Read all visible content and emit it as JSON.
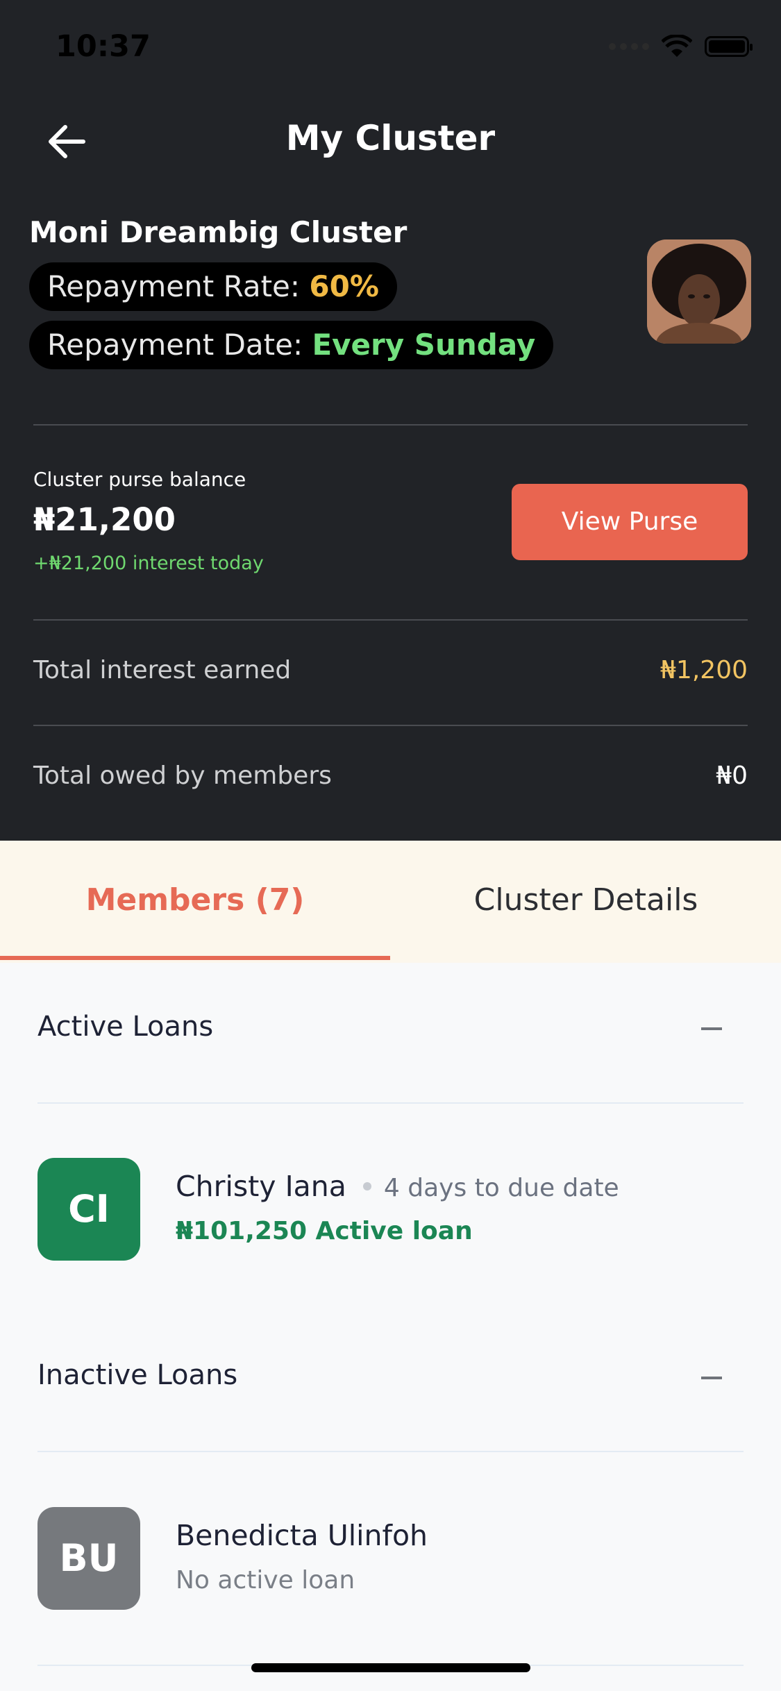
{
  "status": {
    "time": "10:37"
  },
  "header": {
    "title": "My Cluster"
  },
  "cluster": {
    "name": "Moni Dreambig Cluster",
    "repayment_rate_label": "Repayment Rate: ",
    "repayment_rate_value": "60%",
    "repayment_date_label": "Repayment Date: ",
    "repayment_date_value": "Every Sunday"
  },
  "purse": {
    "label": "Cluster purse balance",
    "amount": "₦21,200",
    "interest_today": "+₦21,200 interest today",
    "button_label": "View Purse"
  },
  "stats": {
    "interest_label": "Total interest earned",
    "interest_value": "₦1,200",
    "owed_label": "Total owed by members",
    "owed_value": "₦0"
  },
  "tabs": {
    "members": "Members (7)",
    "details": "Cluster Details"
  },
  "sections": {
    "active_title": "Active Loans",
    "inactive_title": "Inactive Loans"
  },
  "members": {
    "active": [
      {
        "initials": "CI",
        "name": "Christy Iana",
        "due": "4 days to due date",
        "loan": "₦101,250 Active loan"
      }
    ],
    "inactive": [
      {
        "initials": "BU",
        "name": "Benedicta Ulinfoh",
        "loan": "No active loan"
      }
    ]
  },
  "colors": {
    "accent": "#e96550",
    "dark_bg": "#212327",
    "rate_yellow": "#f0b944",
    "date_green": "#73e07f",
    "active_green": "#1b8654"
  }
}
